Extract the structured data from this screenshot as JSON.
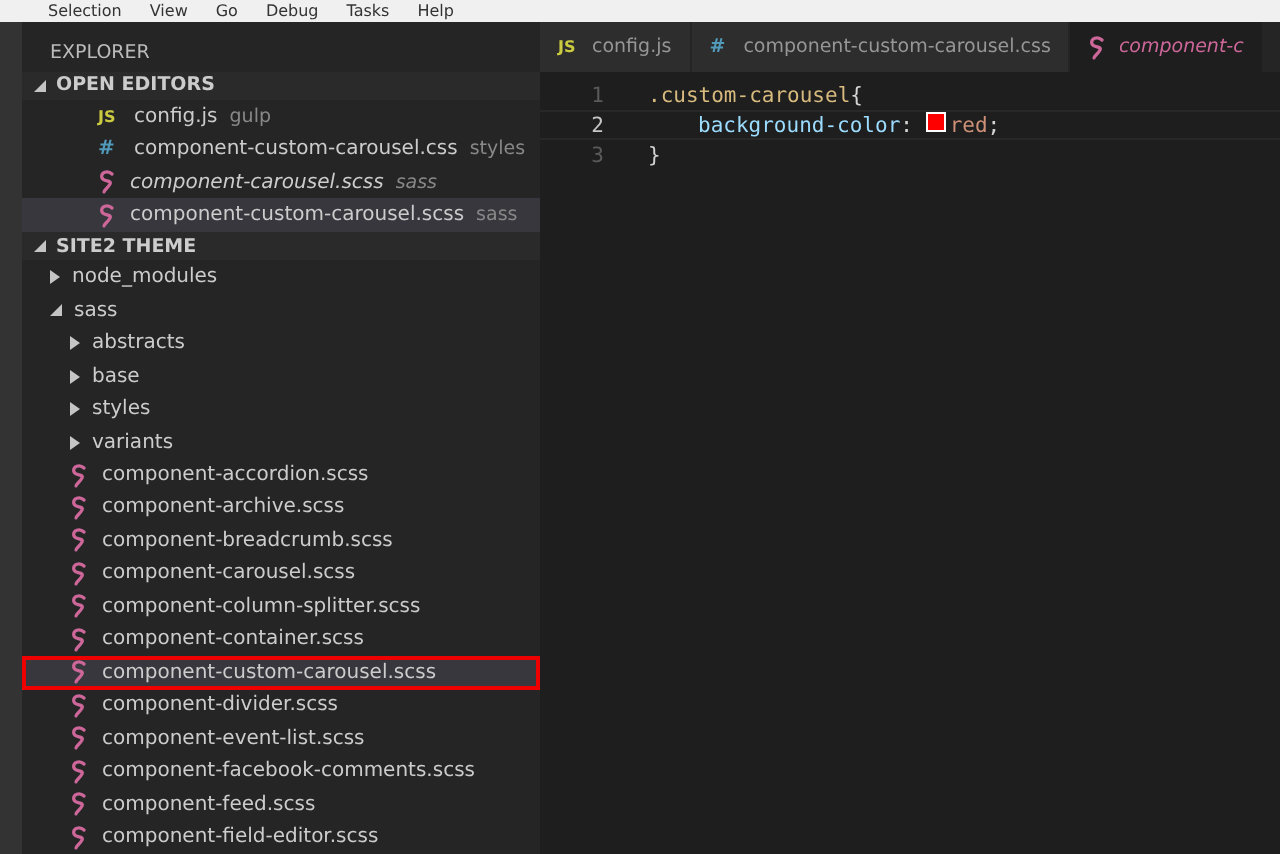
{
  "menu": [
    "Selection",
    "View",
    "Go",
    "Debug",
    "Tasks",
    "Help"
  ],
  "sidebar": {
    "title": "EXPLORER",
    "open_editors": {
      "title": "OPEN EDITORS",
      "expanded": true,
      "items": [
        {
          "kind": "js",
          "icon_text": "JS",
          "name": "config.js",
          "folder": "gulp",
          "italic": false,
          "selected": false
        },
        {
          "kind": "css",
          "icon_text": "#",
          "name": "component-custom-carousel.css",
          "folder": "styles",
          "italic": false,
          "selected": false
        },
        {
          "kind": "scss",
          "name": "component-carousel.scss",
          "folder": "sass",
          "italic": true,
          "selected": false
        },
        {
          "kind": "scss",
          "name": "component-custom-carousel.scss",
          "folder": "sass",
          "italic": false,
          "selected": true
        }
      ]
    },
    "project": {
      "title": "SITE2 THEME",
      "expanded": true,
      "items": [
        {
          "kind": "folder",
          "name": "node_modules",
          "expanded": false,
          "selected": false
        },
        {
          "kind": "folder",
          "name": "sass",
          "expanded": true,
          "selected": false,
          "children": [
            {
              "kind": "folder",
              "name": "abstracts",
              "expanded": false,
              "selected": false
            },
            {
              "kind": "folder",
              "name": "base",
              "expanded": false,
              "selected": false
            },
            {
              "kind": "folder",
              "name": "styles",
              "expanded": false,
              "selected": false
            },
            {
              "kind": "folder",
              "name": "variants",
              "expanded": false,
              "selected": false
            },
            {
              "kind": "scss",
              "name": "component-accordion.scss",
              "selected": false
            },
            {
              "kind": "scss",
              "name": "component-archive.scss",
              "selected": false
            },
            {
              "kind": "scss",
              "name": "component-breadcrumb.scss",
              "selected": false
            },
            {
              "kind": "scss",
              "name": "component-carousel.scss",
              "selected": false
            },
            {
              "kind": "scss",
              "name": "component-column-splitter.scss",
              "selected": false
            },
            {
              "kind": "scss",
              "name": "component-container.scss",
              "selected": false
            },
            {
              "kind": "scss",
              "name": "component-custom-carousel.scss",
              "selected": true,
              "highlighted": true
            },
            {
              "kind": "scss",
              "name": "component-divider.scss",
              "selected": false
            },
            {
              "kind": "scss",
              "name": "component-event-list.scss",
              "selected": false
            },
            {
              "kind": "scss",
              "name": "component-facebook-comments.scss",
              "selected": false
            },
            {
              "kind": "scss",
              "name": "component-feed.scss",
              "selected": false
            },
            {
              "kind": "scss",
              "name": "component-field-editor.scss",
              "selected": false
            }
          ]
        }
      ]
    }
  },
  "tabs": [
    {
      "kind": "js",
      "icon_text": "JS",
      "label": "config.js",
      "italic": false,
      "selected": false
    },
    {
      "kind": "css",
      "icon_text": "#",
      "label": "component-custom-carousel.css",
      "italic": false,
      "selected": false
    },
    {
      "kind": "scss",
      "label": "component-c",
      "italic": true,
      "selected": true
    }
  ],
  "editor": {
    "lines": [
      {
        "number": "1",
        "current": false,
        "tokens": [
          {
            "kind": "selector",
            "text": ".custom-carousel"
          },
          {
            "kind": "punct",
            "text": "{"
          }
        ]
      },
      {
        "number": "2",
        "current": true,
        "tokens": [
          {
            "kind": "property",
            "indent": true,
            "text": "background-color"
          },
          {
            "kind": "punct",
            "text": ": "
          },
          {
            "kind": "swatch",
            "color": "#ff0000"
          },
          {
            "kind": "value",
            "text": "red"
          },
          {
            "kind": "punct",
            "text": ";"
          }
        ]
      },
      {
        "number": "3",
        "current": false,
        "tokens": [
          {
            "kind": "punct",
            "text": "}"
          }
        ]
      }
    ]
  }
}
